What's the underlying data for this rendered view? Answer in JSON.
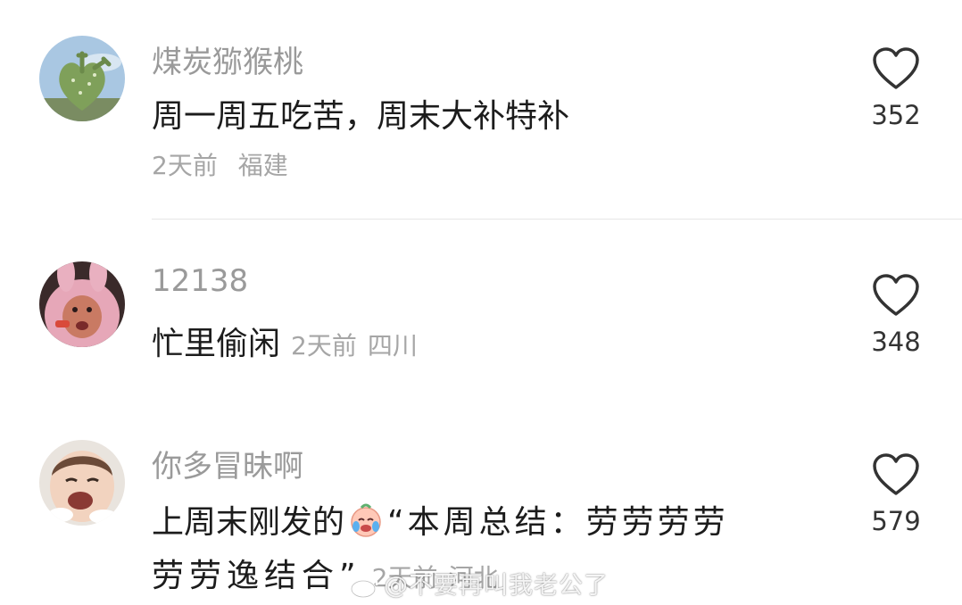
{
  "comments": [
    {
      "username": "煤炭猕猴桃",
      "text": "周一周五吃苦，周末大补特补",
      "time": "2天前",
      "location": "福建",
      "likes": "352",
      "avatar_icon": "cactus-heart-avatar"
    },
    {
      "username": "12138",
      "text": "忙里偷闲",
      "time": "2天前",
      "location": "四川",
      "likes": "348",
      "avatar_icon": "pink-bunny-hood-avatar"
    },
    {
      "username": "你多冒昧啊",
      "text_line1_before": "上周末刚发的",
      "text_line1_after": "“本周总结：劳劳劳劳",
      "text_line2": "劳劳逸结合”",
      "time": "2天前",
      "location": "河北",
      "likes": "579",
      "avatar_icon": "crying-baby-avatar",
      "emoji_icon": "crying-face-emoji"
    }
  ],
  "watermark": "@不要再叫我老公了",
  "colors": {
    "username": "#9a9a9a",
    "meta": "#a6a6a6",
    "text": "#1c1c1c",
    "heart": "#333333"
  }
}
